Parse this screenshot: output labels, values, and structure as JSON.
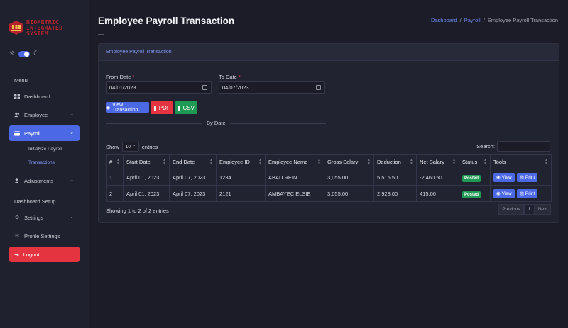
{
  "logo": {
    "line1": "BIOMETRIC",
    "line2": "INTEGRATED",
    "line3": "SYSTEM"
  },
  "sidebar": {
    "menu_label": "Menu",
    "setup_label": "Dashboard Setup",
    "items": [
      {
        "label": "Dashboard",
        "icon": "grid-icon"
      },
      {
        "label": "Employee",
        "icon": "users-icon"
      },
      {
        "label": "Payroll",
        "icon": "card-icon",
        "active": true
      },
      {
        "label": "Adjustments",
        "icon": "user-icon"
      },
      {
        "label": "Settings",
        "icon": "gear-icon"
      },
      {
        "label": "Profile Settings",
        "icon": "gear-icon"
      }
    ],
    "payroll_sub": [
      "Initialyze Payroll",
      "Transactions"
    ],
    "logout_label": "Logout"
  },
  "header": {
    "title": "Employee Payroll Transaction",
    "dash": "—",
    "breadcrumb": [
      "Dashboard",
      "Payroll",
      "Employee Payroll Transaction"
    ]
  },
  "card": {
    "header": "Employee Payroll Transaction",
    "from_label": "From Date",
    "to_label": "To Date",
    "from_value": "04/01/2023",
    "to_value": "04/07/2023",
    "view_btn": "View Transaction",
    "pdf_btn": "PDF",
    "csv_btn": "CSV",
    "by_date": "By Date",
    "show_label": "Show",
    "entries_label": "entries",
    "page_length": "10",
    "search_label": "Search:"
  },
  "table": {
    "columns": [
      "#",
      "Start Date",
      "End Date",
      "Employee ID",
      "Employee Name",
      "Gross Salary",
      "Deduction",
      "Net Salary",
      "Status",
      "Tools"
    ],
    "rows": [
      [
        "1",
        "April 01, 2023",
        "April 07, 2023",
        "1234",
        "ABAD REIN",
        "3,055.00",
        "5,515.50",
        "-2,460.50",
        "Posted"
      ],
      [
        "2",
        "April 01, 2023",
        "April 07, 2023",
        "2121",
        "AMBAYEC ELSIE",
        "3,055.00",
        "2,923.00",
        "415.00",
        "Posted"
      ]
    ],
    "view_label": "View",
    "print_label": "Print"
  },
  "footer": {
    "info": "Showing 1 to 2 of 2 entries",
    "previous": "Previous",
    "page": "1",
    "next": "Next"
  },
  "colors": {
    "accent": "#4b69e4",
    "danger": "#e3343f",
    "success": "#1f9a55",
    "bg": "#1b1c27"
  }
}
